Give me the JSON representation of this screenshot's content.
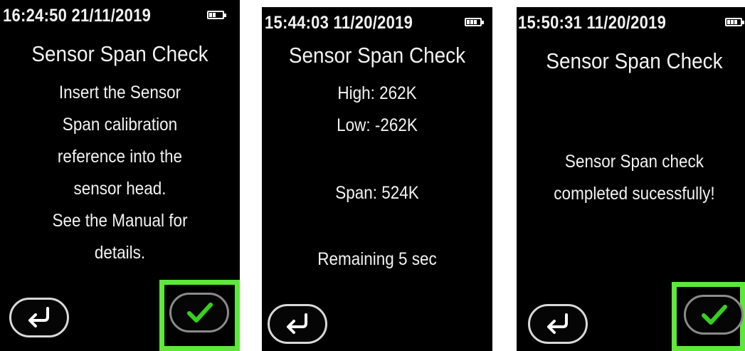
{
  "screens": [
    {
      "datetime": "16:24:50  21/11/2019",
      "title": "Sensor Span Check",
      "lines": [
        "Insert the Sensor",
        "Span calibration",
        "reference into the",
        "sensor head.",
        "See the Manual for",
        "details."
      ],
      "back_icon": "return-arrow-icon",
      "confirm_icon": "checkmark-icon",
      "battery_level": 0.5
    },
    {
      "datetime": "15:44:03  11/20/2019",
      "title": "Sensor Span Check",
      "high": "High: 262K",
      "low": "Low: -262K",
      "span": "Span: 524K",
      "remaining": "Remaining 5 sec",
      "back_icon": "return-arrow-icon",
      "battery_level": 1.0
    },
    {
      "datetime": "15:50:31  11/20/2019",
      "title": "Sensor Span Check",
      "lines": [
        "Sensor Span check",
        "completed sucessfully!"
      ],
      "back_icon": "return-arrow-icon",
      "confirm_icon": "checkmark-icon",
      "battery_level": 1.0
    }
  ],
  "colors": {
    "screen_bg": "#000000",
    "text": "#f2f2f2",
    "highlight": "#5ee83a",
    "checkmark": "#36d11f"
  }
}
